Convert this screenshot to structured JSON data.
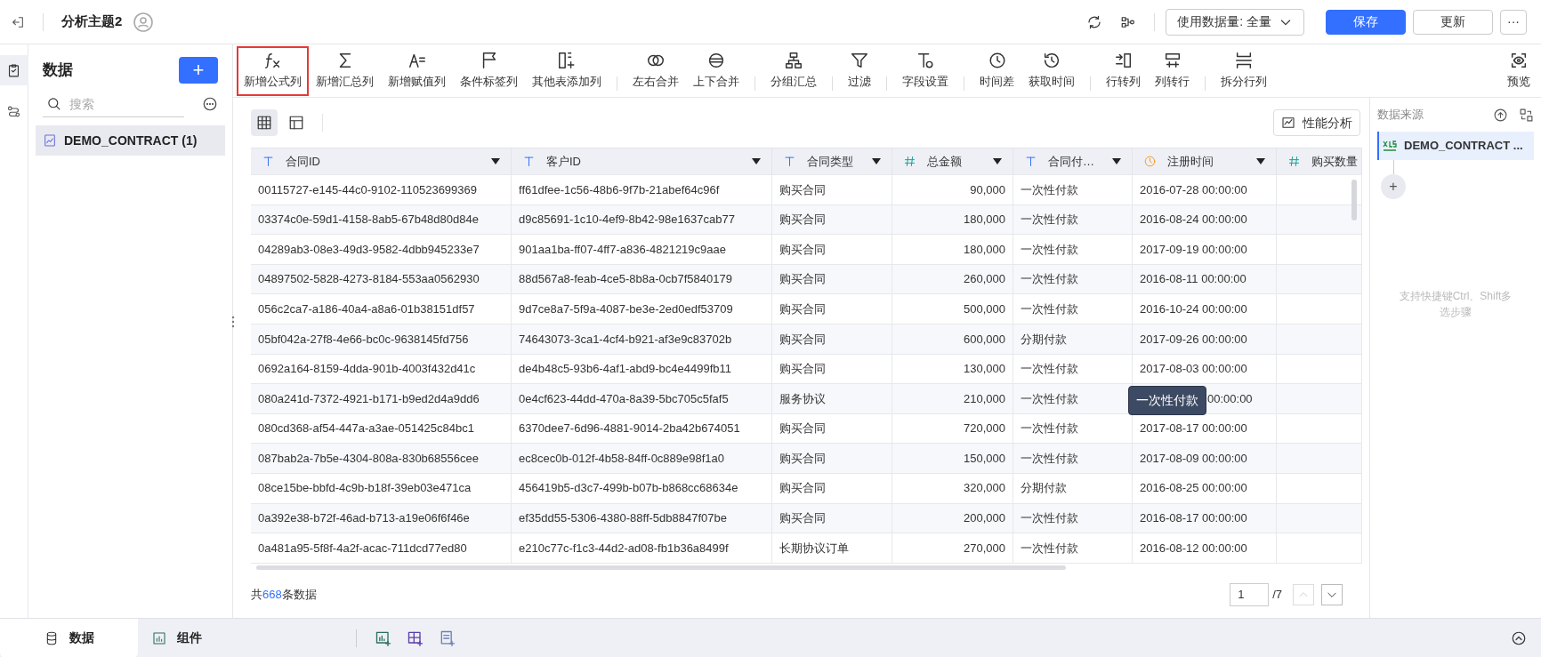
{
  "topbar": {
    "title": "分析主题2",
    "data_scope": "使用数据量: 全量",
    "buttons": [
      {
        "label": "保存",
        "kind": "primary"
      },
      {
        "label": "更新",
        "kind": "default"
      },
      {
        "label": "···",
        "kind": "more"
      }
    ]
  },
  "rail": [
    {
      "selected": true
    },
    {
      "selected": false
    }
  ],
  "data_panel": {
    "title": "数据",
    "add": "+",
    "search": {
      "placeholder": "搜索"
    },
    "items": [
      {
        "label": "DEMO_CONTRACT (1)",
        "selected": true
      }
    ]
  },
  "toolbar": {
    "groups": [
      [
        {
          "label": "新增公式列",
          "highlighted": true
        },
        {
          "label": "新增汇总列",
          "highlighted": false
        },
        {
          "label": "新增赋值列",
          "highlighted": false
        },
        {
          "label": "条件标签列",
          "highlighted": false
        },
        {
          "label": "其他表添加列",
          "highlighted": false
        }
      ],
      [
        {
          "label": "左右合并",
          "highlighted": false
        },
        {
          "label": "上下合并",
          "highlighted": false
        }
      ],
      [
        {
          "label": "分组汇总",
          "highlighted": false
        }
      ],
      [
        {
          "label": "过滤",
          "highlighted": false
        }
      ],
      [
        {
          "label": "字段设置",
          "highlighted": false
        }
      ],
      [
        {
          "label": "时间差",
          "highlighted": false
        },
        {
          "label": "获取时间",
          "highlighted": false
        }
      ],
      [
        {
          "label": "行转列",
          "highlighted": false
        },
        {
          "label": "列转行",
          "highlighted": false
        }
      ],
      [
        {
          "label": "拆分行列",
          "highlighted": false
        }
      ]
    ],
    "preview": "预览"
  },
  "view_toggles": [
    {
      "selected": true
    },
    {
      "selected": false
    }
  ],
  "perf_button": "性能分析",
  "table": {
    "columns": [
      {
        "label": "合同ID",
        "kind": "text"
      },
      {
        "label": "客户ID",
        "kind": "text"
      },
      {
        "label": "合同类型",
        "kind": "text"
      },
      {
        "label": "总金额",
        "kind": "number"
      },
      {
        "label": "合同付…",
        "kind": "text"
      },
      {
        "label": "注册时间",
        "kind": "date"
      },
      {
        "label": "购买数量",
        "kind": "number"
      }
    ],
    "rows": [
      {
        "cells": [
          "00115727-e145-44c0-9102-110523699369",
          "ff61dfee-1c56-48b6-9f7b-21abef64c96f",
          "购买合同",
          "90,000",
          "一次性付款",
          "2016-07-28 00:00:00"
        ]
      },
      {
        "cells": [
          "03374c0e-59d1-4158-8ab5-67b48d80d84e",
          "d9c85691-1c10-4ef9-8b42-98e1637cab77",
          "购买合同",
          "180,000",
          "一次性付款",
          "2016-08-24 00:00:00"
        ]
      },
      {
        "cells": [
          "04289ab3-08e3-49d3-9582-4dbb945233e7",
          "901aa1ba-ff07-4ff7-a836-4821219c9aae",
          "购买合同",
          "180,000",
          "一次性付款",
          "2017-09-19 00:00:00"
        ]
      },
      {
        "cells": [
          "04897502-5828-4273-8184-553aa0562930",
          "88d567a8-feab-4ce5-8b8a-0cb7f5840179",
          "购买合同",
          "260,000",
          "一次性付款",
          "2016-08-11 00:00:00"
        ]
      },
      {
        "cells": [
          "056c2ca7-a186-40a4-a8a6-01b38151df57",
          "9d7ce8a7-5f9a-4087-be3e-2ed0edf53709",
          "购买合同",
          "500,000",
          "一次性付款",
          "2016-10-24 00:00:00"
        ]
      },
      {
        "cells": [
          "05bf042a-27f8-4e66-bc0c-9638145fd756",
          "74643073-3ca1-4cf4-b921-af3e9c83702b",
          "购买合同",
          "600,000",
          "分期付款",
          "2017-09-26 00:00:00"
        ]
      },
      {
        "cells": [
          "0692a164-8159-4dda-901b-4003f432d41c",
          "de4b48c5-93b6-4af1-abd9-bc4e4499fb11",
          "购买合同",
          "130,000",
          "一次性付款",
          "2017-08-03 00:00:00"
        ]
      },
      {
        "cells": [
          "080a241d-7372-4921-b171-b9ed2d4a9dd6",
          "0e4cf623-44dd-470a-8a39-5bc705c5faf5",
          "服务协议",
          "210,000",
          "一次性付款",
          "00:00:00"
        ],
        "tooltip": "一次性付款"
      },
      {
        "cells": [
          "080cd368-af54-447a-a3ae-051425c84bc1",
          "6370dee7-6d96-4881-9014-2ba42b674051",
          "购买合同",
          "720,000",
          "一次性付款",
          "2017-08-17 00:00:00"
        ]
      },
      {
        "cells": [
          "087bab2a-7b5e-4304-808a-830b68556cee",
          "ec8cec0b-012f-4b58-84ff-0c889e98f1a0",
          "购买合同",
          "150,000",
          "一次性付款",
          "2017-08-09 00:00:00"
        ]
      },
      {
        "cells": [
          "08ce15be-bbfd-4c9b-b18f-39eb03e471ca",
          "456419b5-d3c7-499b-b07b-b868cc68634e",
          "购买合同",
          "320,000",
          "分期付款",
          "2016-08-25 00:00:00"
        ]
      },
      {
        "cells": [
          "0a392e38-b72f-46ad-b713-a19e06f6f46e",
          "ef35dd55-5306-4380-88ff-5db8847f07be",
          "购买合同",
          "200,000",
          "一次性付款",
          "2016-08-17 00:00:00"
        ]
      },
      {
        "cells": [
          "0a481a95-5f8f-4a2f-acac-711dcd77ed80",
          "e210c77c-f1c3-44d2-ad08-fb1b36a8499f",
          "长期协议订单",
          "270,000",
          "一次性付款",
          "2016-08-12 00:00:00"
        ]
      }
    ]
  },
  "footer": {
    "prefix": "共",
    "count": "668",
    "suffix": "条数据",
    "page": "1",
    "pages": "/7",
    "prev_disabled": true
  },
  "right_panel": {
    "title": "数据来源",
    "steps": [
      {
        "label": "DEMO_CONTRACT ...",
        "selected": true
      }
    ],
    "add": "+",
    "hint": "支持快捷键Ctrl、Shift多选步骤"
  },
  "bottom_tabs": [
    {
      "label": "数据",
      "selected": true
    },
    {
      "label": "组件",
      "selected": false
    }
  ]
}
